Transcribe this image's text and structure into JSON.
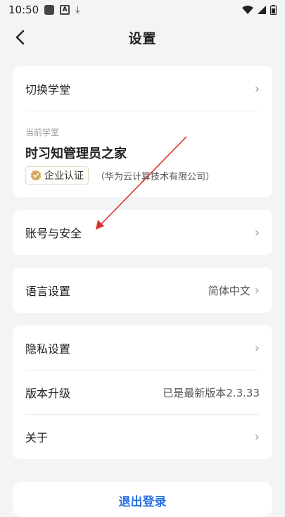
{
  "status_bar": {
    "time": "10:50"
  },
  "header": {
    "title": "设置"
  },
  "school_card": {
    "switch_label": "切换学堂",
    "current_label": "当前学堂",
    "school_name": "时习知管理员之家",
    "cert_badge": "企业认证",
    "company": "（华为云计算技术有限公司）"
  },
  "account": {
    "label": "账号与安全"
  },
  "language": {
    "label": "语言设置",
    "value": "简体中文"
  },
  "misc": {
    "privacy_label": "隐私设置",
    "upgrade_label": "版本升级",
    "upgrade_value": "已是最新版本2.3.33",
    "about_label": "关于"
  },
  "logout": {
    "label": "退出登录"
  },
  "colors": {
    "accent": "#2a72e4",
    "background": "#f3f4f6",
    "annotation_arrow": "#d8322f"
  }
}
